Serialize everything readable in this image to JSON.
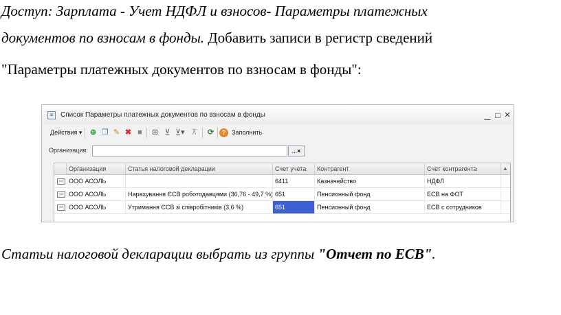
{
  "doc": {
    "line1": "Доступ: Зарплата - Учет НДФЛ и взносов- Параметры платежных",
    "line2_italic": "документов по взносам в фонды.",
    "line2_rest": " Добавить записи в регистр сведений",
    "line3": "\"Параметры платежных документов по взносам в фонды\":",
    "footer_text": "Статьи налоговой декларации выбрать из группы ",
    "footer_bold": "\"Отчет по ЕСВ\"",
    "footer_end": "."
  },
  "window": {
    "title": "Список Параметры платежных документов по взносам в фонды",
    "minimize": "_",
    "restore": "□",
    "close": "×"
  },
  "toolbar": {
    "actions_label": "Действия ▾",
    "fill_label": "Заполнить",
    "icons": [
      "add-icon",
      "copy-icon",
      "edit-icon",
      "delete-icon",
      "stop-icon",
      "filter-icon",
      "filter-settings-icon",
      "filter-dropdown-icon",
      "clear-filter-icon",
      "refresh-icon",
      "help-icon"
    ]
  },
  "org": {
    "label": "Организация:",
    "value": "",
    "button": "...",
    "clear": "×"
  },
  "table": {
    "columns": [
      "Организация",
      "Статья налоговой декларации",
      "Счет учета",
      "Контрагент",
      "Счет контрагента"
    ],
    "rows": [
      [
        "ООО АСОЛЬ",
        "",
        "6411",
        "Казначейство",
        "НДФЛ"
      ],
      [
        "ООО АСОЛЬ",
        "Нарахування ЄСВ роботодавцями (36,76 - 49,7 %)",
        "651",
        "Пенсионный фонд",
        "ЕСВ на ФОТ"
      ],
      [
        "ООО АСОЛЬ",
        "Утримання ЄСВ зі співробітників (3,6 %)",
        "651",
        "Пенсионный фонд",
        "ЕСВ с сотрудников"
      ]
    ],
    "selected_row": 2,
    "selected_col": 2,
    "sort_indicator": "▲"
  },
  "colors": {
    "selection": "#3d5fd1",
    "window_bg": "#f2f2f2"
  }
}
